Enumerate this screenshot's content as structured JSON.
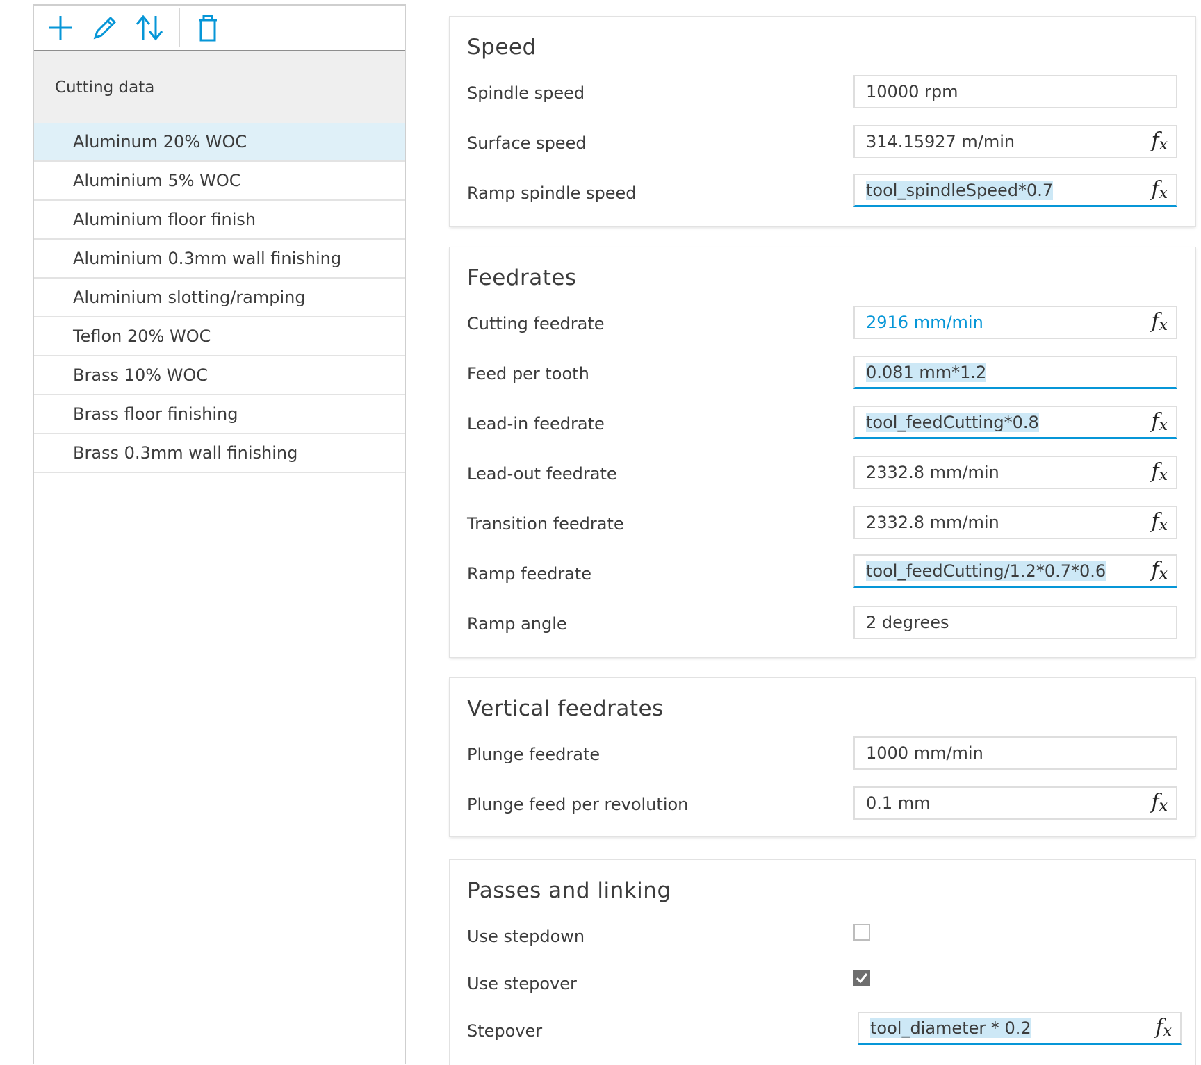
{
  "toolbar": {
    "add_icon": "plus-icon",
    "edit_icon": "pencil-icon",
    "sort_icon": "sort-arrows-icon",
    "delete_icon": "trash-icon"
  },
  "list": {
    "header": "Cutting data",
    "items": [
      "Aluminum 20% WOC",
      "Aluminium 5% WOC",
      "Aluminium floor finish",
      "Aluminium 0.3mm wall finishing",
      "Aluminium slotting/ramping",
      "Teflon 20% WOC",
      "Brass 10% WOC",
      "Brass floor finishing",
      "Brass 0.3mm wall finishing"
    ],
    "selected_index": 0
  },
  "fx_label": "fx",
  "speed": {
    "title": "Speed",
    "spindle_speed": {
      "label": "Spindle speed",
      "value": "10000 rpm"
    },
    "surface_speed": {
      "label": "Surface speed",
      "value": "314.15927 m/min"
    },
    "ramp_spindle_speed": {
      "label": "Ramp spindle speed",
      "value": "tool_spindleSpeed*0.7"
    }
  },
  "feedrates": {
    "title": "Feedrates",
    "cutting_feedrate": {
      "label": "Cutting feedrate",
      "value": "2916 mm/min"
    },
    "feed_per_tooth": {
      "label": "Feed per tooth",
      "value": "0.081 mm*1.2"
    },
    "lead_in_feedrate": {
      "label": "Lead-in feedrate",
      "value": "tool_feedCutting*0.8"
    },
    "lead_out_feedrate": {
      "label": "Lead-out feedrate",
      "value": "2332.8 mm/min"
    },
    "transition_feedrate": {
      "label": "Transition feedrate",
      "value": "2332.8 mm/min"
    },
    "ramp_feedrate": {
      "label": "Ramp feedrate",
      "value": "tool_feedCutting/1.2*0.7*0.6"
    },
    "ramp_angle": {
      "label": "Ramp angle",
      "value": "2 degrees"
    }
  },
  "vertical_feedrates": {
    "title": "Vertical feedrates",
    "plunge_feedrate": {
      "label": "Plunge feedrate",
      "value": "1000 mm/min"
    },
    "plunge_feed_per_revolution": {
      "label": "Plunge feed per revolution",
      "value": "0.1 mm"
    }
  },
  "passes": {
    "title": "Passes and linking",
    "use_stepdown": {
      "label": "Use stepdown",
      "checked": false
    },
    "use_stepover": {
      "label": "Use stepover",
      "checked": true
    },
    "stepover": {
      "label": "Stepover",
      "value": "tool_diameter * 0.2"
    }
  },
  "colors": {
    "accent": "#0696d7",
    "selection": "#dff0f8",
    "highlight": "#cde8f6"
  }
}
